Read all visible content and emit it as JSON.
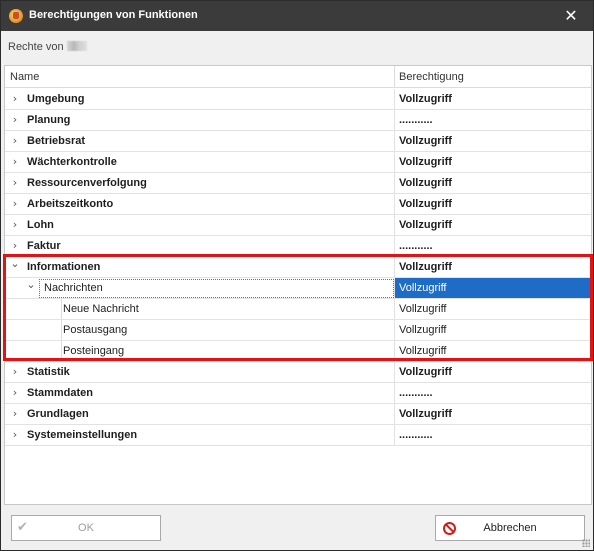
{
  "window": {
    "title": "Berechtigungen von Funktionen",
    "close_glyph": "✕",
    "accent_title_bar": "#3b3b3b",
    "selection_color": "#1f6cc6",
    "highlight_color": "#e01414"
  },
  "header": {
    "rechte_label": "Rechte von"
  },
  "grid": {
    "columns": [
      "Name",
      "Berechtigung"
    ],
    "rows": [
      {
        "name": "Umgebung",
        "level": 0,
        "expanded": false,
        "permission": "Vollzugriff"
      },
      {
        "name": "Planung",
        "level": 0,
        "expanded": false,
        "permission": "..........."
      },
      {
        "name": "Betriebsrat",
        "level": 0,
        "expanded": false,
        "permission": "Vollzugriff"
      },
      {
        "name": "Wächterkontrolle",
        "level": 0,
        "expanded": false,
        "permission": "Vollzugriff"
      },
      {
        "name": "Ressourcenverfolgung",
        "level": 0,
        "expanded": false,
        "permission": "Vollzugriff"
      },
      {
        "name": "Arbeitszeitkonto",
        "level": 0,
        "expanded": false,
        "permission": "Vollzugriff"
      },
      {
        "name": "Lohn",
        "level": 0,
        "expanded": false,
        "permission": "Vollzugriff"
      },
      {
        "name": "Faktur",
        "level": 0,
        "expanded": false,
        "permission": "..........."
      },
      {
        "name": "Informationen",
        "level": 0,
        "expanded": true,
        "permission": "Vollzugriff"
      },
      {
        "name": "Nachrichten",
        "level": 1,
        "expanded": true,
        "permission": "Vollzugriff",
        "selected": true
      },
      {
        "name": "Neue Nachricht",
        "level": 2,
        "permission": "Vollzugriff"
      },
      {
        "name": "Postausgang",
        "level": 2,
        "permission": "Vollzugriff"
      },
      {
        "name": "Posteingang",
        "level": 2,
        "permission": "Vollzugriff"
      },
      {
        "name": "Statistik",
        "level": 0,
        "expanded": false,
        "permission": "Vollzugriff"
      },
      {
        "name": "Stammdaten",
        "level": 0,
        "expanded": false,
        "permission": "..........."
      },
      {
        "name": "Grundlagen",
        "level": 0,
        "expanded": false,
        "permission": "Vollzugriff"
      },
      {
        "name": "Systemeinstellungen",
        "level": 0,
        "expanded": false,
        "permission": "..........."
      }
    ]
  },
  "footer": {
    "ok_label": "OK",
    "cancel_label": "Abbrechen"
  },
  "icons": {
    "app": "app-icon",
    "close": "close-icon",
    "expand": "chevron-right-icon",
    "collapse": "chevron-down-icon",
    "ok": "checkmark-icon",
    "cancel": "cancel-icon"
  }
}
